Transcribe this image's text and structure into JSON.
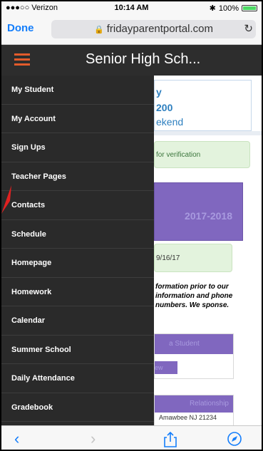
{
  "status_bar": {
    "carrier": "●●●○○ Verizon",
    "time": "10:14 AM",
    "battery": "100%",
    "battery_level": 1.0
  },
  "browser": {
    "done_label": "Done",
    "url": "fridayparentportal.com",
    "lock_icon": "lock-icon",
    "reload_icon": "reload-icon",
    "toolbar_icons": [
      "back-icon",
      "forward-icon",
      "share-icon",
      "compass-icon"
    ]
  },
  "site": {
    "title": "Senior High Sch...",
    "accent": "#e35b2b",
    "menu": [
      "My Student",
      "My Account",
      "Sign Ups",
      "Teacher Pages",
      "Contacts",
      "Schedule",
      "Homepage",
      "Homework",
      "Calendar",
      "Summer School",
      "Daily Attendance",
      "Gradebook"
    ]
  },
  "content": {
    "card_line1": "y",
    "card_line2": "200",
    "card_line3": "ekend",
    "notice_verification": "for verification",
    "year": "2017-2018",
    "date_notice": "9/16/17",
    "paragraph": "formation prior to our information and phone numbers.  We sponse.",
    "panel_header": "a Student",
    "panel_button": "ew",
    "relationship": "Relationship",
    "address": "Amawbee NJ 21234"
  }
}
